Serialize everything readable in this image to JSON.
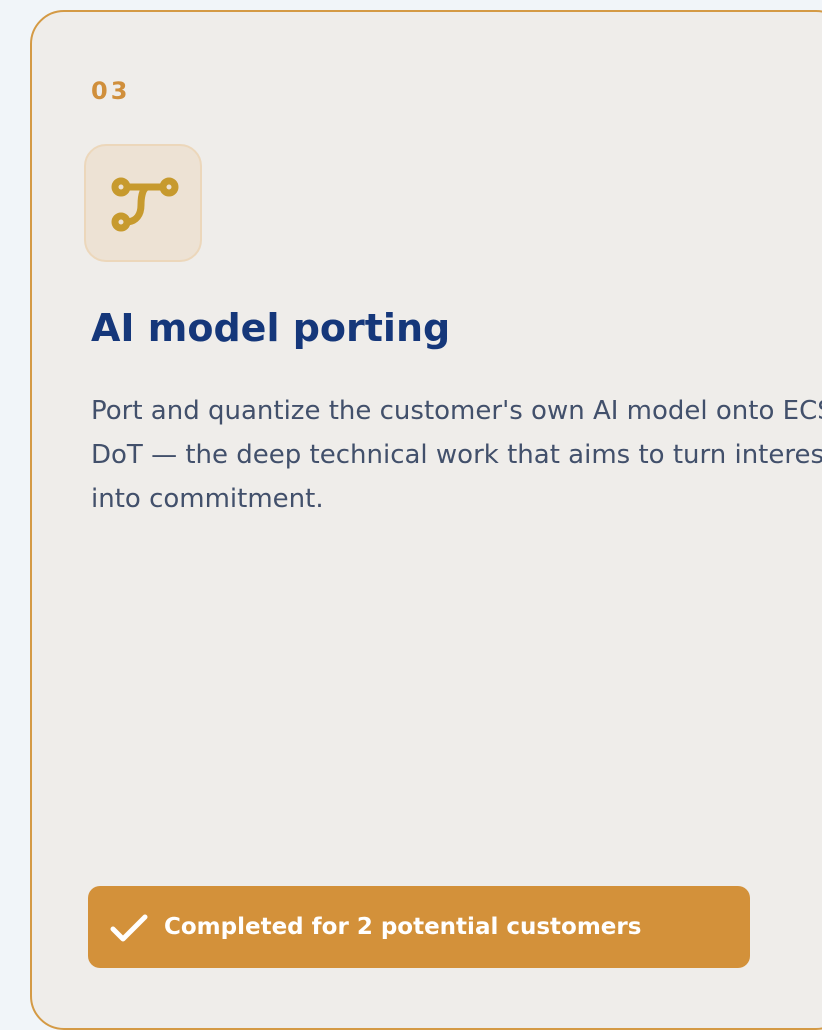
{
  "card": {
    "step_number": "03",
    "icon": "route-icon",
    "title": "AI model porting",
    "description": "Port and quantize the customer's own AI model onto ECS-DoT — the deep technical work that aims to turn interest into commitment.",
    "status": {
      "icon": "check-icon",
      "label": "Completed for 2 potential customers"
    }
  },
  "colors": {
    "page_background": "#f1f5f9",
    "card_background": "#efedea",
    "card_border": "#d49a45",
    "accent": "#d08f3b",
    "icon_stroke": "#c79a2e",
    "title": "#15377a",
    "body_text": "#42506b",
    "badge_background": "#d3913a",
    "badge_text": "#ffffff"
  }
}
